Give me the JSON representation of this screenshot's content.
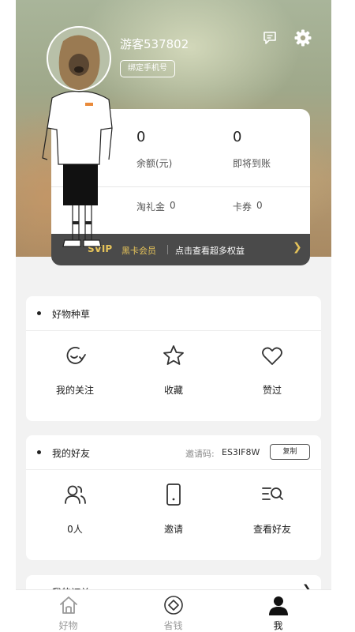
{
  "profile": {
    "username": "游客537802",
    "bind_phone_label": "绑定手机号"
  },
  "wallet": {
    "balance_value": "0",
    "balance_label": "余额(元)",
    "pending_value": "0",
    "pending_label": "即将到账",
    "gift_label": "淘礼金",
    "gift_value": "0",
    "coupon_label": "卡券",
    "coupon_value": "0"
  },
  "svip": {
    "badge": "SVIP",
    "member_label": "黑卡会员",
    "description": "点击查看超多权益",
    "arrow": "❯"
  },
  "goods": {
    "title": "好物种草",
    "items": [
      {
        "label": "我的关注",
        "icon": "follow-icon"
      },
      {
        "label": "收藏",
        "icon": "star-icon"
      },
      {
        "label": "赞过",
        "icon": "heart-icon"
      }
    ]
  },
  "friends": {
    "title": "我的好友",
    "invite_label": "邀请码:",
    "invite_code": "ES3IF8W",
    "copy_label": "复制",
    "items": [
      {
        "label": "0人",
        "icon": "friends-icon"
      },
      {
        "label": "邀请",
        "icon": "phone-icon"
      },
      {
        "label": "查看好友",
        "icon": "search-list-icon"
      }
    ]
  },
  "orders": {
    "title": "我的订单",
    "arrow": "❯"
  },
  "tabbar": {
    "tabs": [
      {
        "label": "好物",
        "icon": "home-icon",
        "active": false
      },
      {
        "label": "省钱",
        "icon": "diamond-icon",
        "active": false
      },
      {
        "label": "我",
        "icon": "person-icon",
        "active": true
      }
    ]
  },
  "colors": {
    "gold": "#e5c35a",
    "svip_bar": "#4a4a4a",
    "background": "#f2f2f2"
  }
}
